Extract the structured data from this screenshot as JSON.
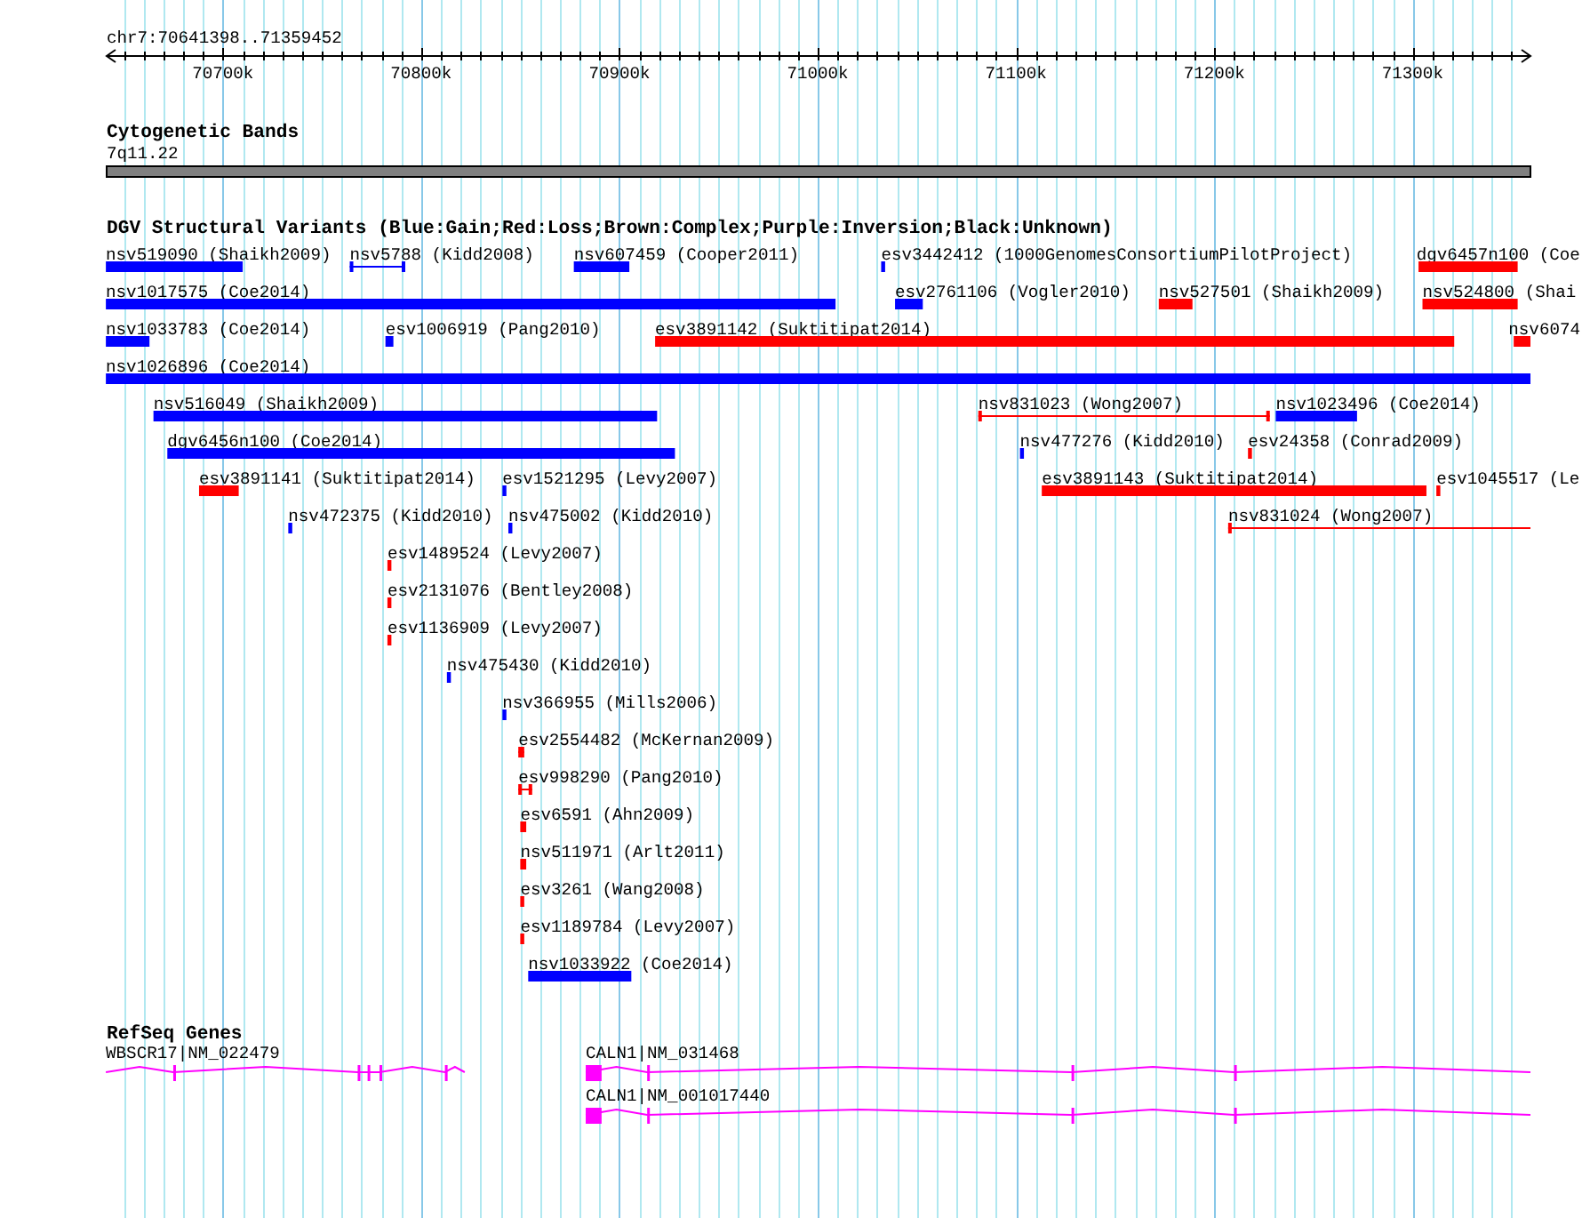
{
  "ruler": {
    "region": "chr7:70641398..71359452",
    "ticks": [
      "70700k",
      "70800k",
      "70900k",
      "71000k",
      "71100k",
      "71200k",
      "71300k"
    ]
  },
  "cytogenetic_bands": {
    "title": "Cytogenetic Bands",
    "band": "7q11.22"
  },
  "variants": {
    "title": "DGV Structural Variants (Blue:Gain;Red:Loss;Brown:Complex;Purple:Inversion;Black:Unknown)",
    "rows": [
      {
        "features": [
          {
            "label": "nsv519090 (Shaikh2009)",
            "kind": "bar",
            "color": "#0000ff"
          },
          {
            "label": "nsv5788 (Kidd2008)",
            "kind": "interval",
            "color": "#0000ff"
          },
          {
            "label": "nsv607459 (Cooper2011)",
            "kind": "bar",
            "color": "#0000ff"
          },
          {
            "label": "esv3442412 (1000GenomesConsortiumPilotProject)",
            "kind": "bar",
            "color": "#0000ff"
          },
          {
            "label": "dgv6457n100 (Coe",
            "kind": "bar",
            "color": "#ff0000"
          }
        ]
      },
      {
        "features": [
          {
            "label": "nsv1017575 (Coe2014)",
            "kind": "bar",
            "color": "#0000ff"
          },
          {
            "label": "esv2761106 (Vogler2010)",
            "kind": "bar",
            "color": "#0000ff"
          },
          {
            "label": "nsv527501 (Shaikh2009)",
            "kind": "bar",
            "color": "#ff0000"
          },
          {
            "label": "nsv524800 (Shai",
            "kind": "bar",
            "color": "#ff0000"
          }
        ]
      },
      {
        "features": [
          {
            "label": "nsv1033783 (Coe2014)",
            "kind": "bar",
            "color": "#0000ff"
          },
          {
            "label": "esv1006919 (Pang2010)",
            "kind": "bar",
            "color": "#0000ff"
          },
          {
            "label": "esv3891142 (Suktitipat2014)",
            "kind": "bar",
            "color": "#ff0000"
          },
          {
            "label": "nsv6074",
            "kind": "bar",
            "color": "#ff0000"
          }
        ]
      },
      {
        "features": [
          {
            "label": "nsv1026896 (Coe2014)",
            "kind": "bar",
            "color": "#0000ff"
          }
        ]
      },
      {
        "features": [
          {
            "label": "nsv516049 (Shaikh2009)",
            "kind": "bar",
            "color": "#0000ff"
          },
          {
            "label": "nsv831023 (Wong2007)",
            "kind": "interval",
            "color": "#ff0000"
          },
          {
            "label": "nsv1023496 (Coe2014)",
            "kind": "bar",
            "color": "#0000ff"
          }
        ]
      },
      {
        "features": [
          {
            "label": "dgv6456n100 (Coe2014)",
            "kind": "bar",
            "color": "#0000ff"
          },
          {
            "label": "nsv477276 (Kidd2010)",
            "kind": "bar",
            "color": "#0000ff"
          },
          {
            "label": "esv24358 (Conrad2009)",
            "kind": "bar",
            "color": "#ff0000"
          }
        ]
      },
      {
        "features": [
          {
            "label": "esv3891141 (Suktitipat2014)",
            "kind": "bar",
            "color": "#ff0000"
          },
          {
            "label": "esv1521295 (Levy2007)",
            "kind": "bar",
            "color": "#0000ff"
          },
          {
            "label": "esv3891143 (Suktitipat2014)",
            "kind": "bar",
            "color": "#ff0000"
          },
          {
            "label": "esv1045517 (Le",
            "kind": "bar",
            "color": "#ff0000"
          }
        ]
      },
      {
        "features": [
          {
            "label": "nsv472375 (Kidd2010)",
            "kind": "bar",
            "color": "#0000ff"
          },
          {
            "label": "nsv475002 (Kidd2010)",
            "kind": "bar",
            "color": "#0000ff"
          },
          {
            "label": "nsv831024 (Wong2007)",
            "kind": "interval",
            "color": "#ff0000"
          }
        ]
      },
      {
        "features": [
          {
            "label": "esv1489524 (Levy2007)",
            "kind": "bar",
            "color": "#ff0000"
          }
        ]
      },
      {
        "features": [
          {
            "label": "esv2131076 (Bentley2008)",
            "kind": "bar",
            "color": "#ff0000"
          }
        ]
      },
      {
        "features": [
          {
            "label": "esv1136909 (Levy2007)",
            "kind": "bar",
            "color": "#ff0000"
          }
        ]
      },
      {
        "features": [
          {
            "label": "nsv475430 (Kidd2010)",
            "kind": "bar",
            "color": "#0000ff"
          }
        ]
      },
      {
        "features": [
          {
            "label": "nsv366955 (Mills2006)",
            "kind": "bar",
            "color": "#0000ff"
          }
        ]
      },
      {
        "features": [
          {
            "label": "esv2554482 (McKernan2009)",
            "kind": "interval",
            "color": "#ff0000"
          }
        ]
      },
      {
        "features": [
          {
            "label": "esv998290 (Pang2010)",
            "kind": "interval",
            "color": "#ff0000"
          }
        ]
      },
      {
        "features": [
          {
            "label": "esv6591 (Ahn2009)",
            "kind": "bar",
            "color": "#ff0000"
          }
        ]
      },
      {
        "features": [
          {
            "label": "nsv511971 (Arlt2011)",
            "kind": "bar",
            "color": "#ff0000"
          }
        ]
      },
      {
        "features": [
          {
            "label": "esv3261 (Wang2008)",
            "kind": "bar",
            "color": "#ff0000"
          }
        ]
      },
      {
        "features": [
          {
            "label": "esv1189784 (Levy2007)",
            "kind": "bar",
            "color": "#ff0000"
          }
        ]
      },
      {
        "features": [
          {
            "label": "nsv1033922 (Coe2014)",
            "kind": "bar",
            "color": "#0000ff"
          }
        ]
      }
    ]
  },
  "refseq_genes": {
    "title": "RefSeq Genes",
    "genes": [
      "WBSCR17|NM_022479",
      "CALN1|NM_031468",
      "CALN1|NM_001017440"
    ]
  }
}
